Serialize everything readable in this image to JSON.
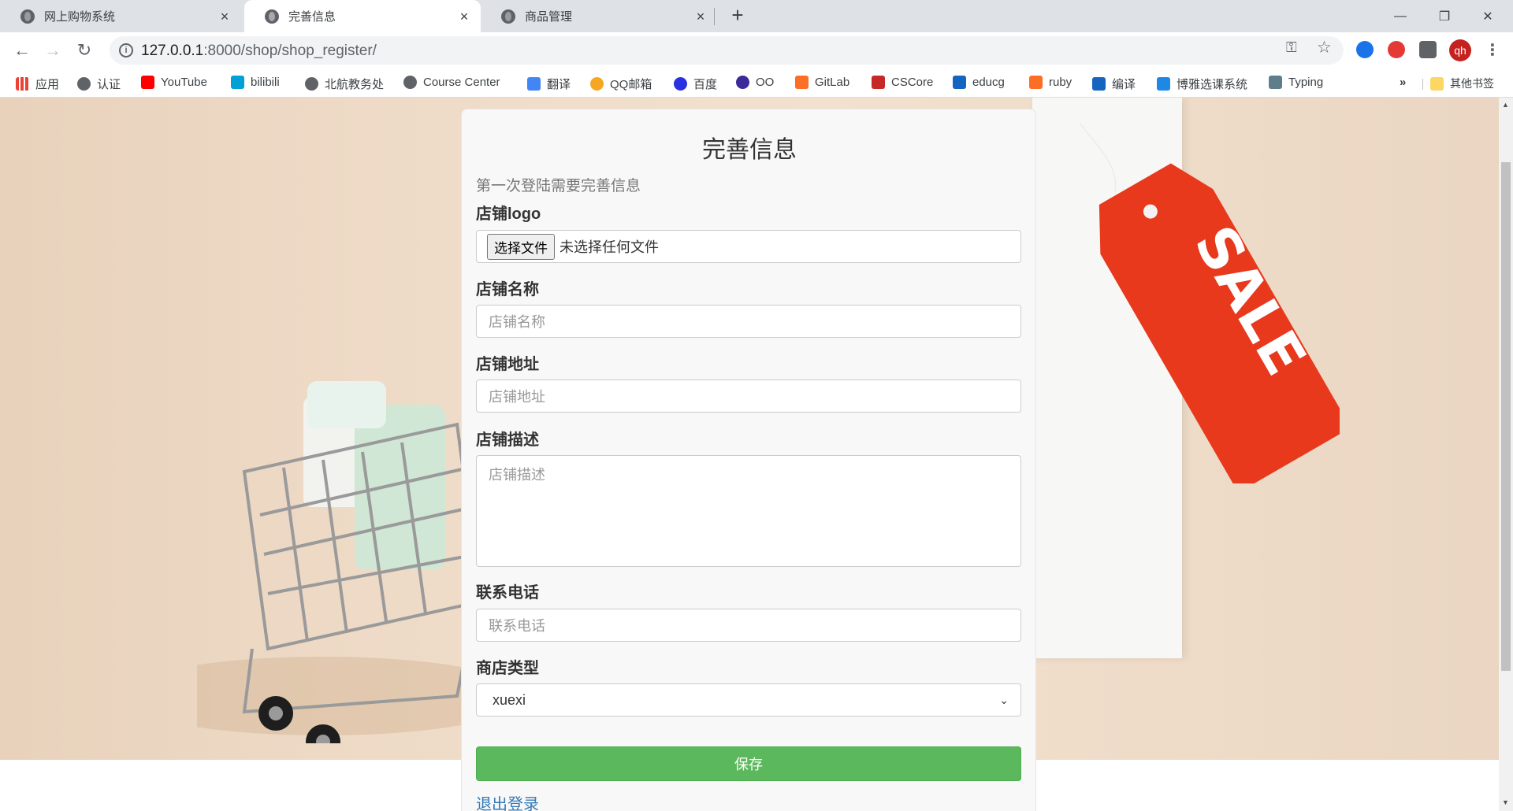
{
  "browser": {
    "tabs": [
      {
        "title": "网上购物系统",
        "active": false
      },
      {
        "title": "完善信息",
        "active": true
      },
      {
        "title": "商品管理",
        "active": false
      }
    ],
    "new_tab": "+",
    "window_controls": {
      "minimize": "—",
      "restore": "❐",
      "close": "✕"
    },
    "nav": {
      "back": "←",
      "forward": "→",
      "reload": "↻"
    },
    "url_host": "127.0.0.1",
    "url_rest": ":8000/shop/shop_register/",
    "omnibox_icons": {
      "key": "⚿",
      "star": "☆"
    },
    "avatar": "qh",
    "menu": "⋮",
    "extension_colors": [
      "#1a73e8",
      "#e53935",
      "#5f6368"
    ],
    "bookmarks": [
      {
        "label": "应用",
        "icon": "apps-icon",
        "color": "#ea4335"
      },
      {
        "label": "认证",
        "icon": "globe-icon",
        "color": "#5f6368"
      },
      {
        "label": "YouTube",
        "icon": "youtube-icon",
        "color": "#ff0000"
      },
      {
        "label": "bilibili",
        "icon": "bilibili-icon",
        "color": "#00a1d6"
      },
      {
        "label": "北航教务处",
        "icon": "globe-icon",
        "color": "#5f6368"
      },
      {
        "label": "Course Center",
        "icon": "globe-icon",
        "color": "#5f6368"
      },
      {
        "label": "翻译",
        "icon": "translate-icon",
        "color": "#4285f4"
      },
      {
        "label": "QQ邮箱",
        "icon": "qqmail-icon",
        "color": "#f5a623"
      },
      {
        "label": "百度",
        "icon": "baidu-icon",
        "color": "#2932e1"
      },
      {
        "label": "OO",
        "icon": "hexagon-icon",
        "color": "#3c2a9b"
      },
      {
        "label": "GitLab",
        "icon": "gitlab-icon",
        "color": "#fc6d26"
      },
      {
        "label": "CSCore",
        "icon": "cscore-icon",
        "color": "#c62828"
      },
      {
        "label": "educg",
        "icon": "educg-icon",
        "color": "#1565c0"
      },
      {
        "label": "ruby",
        "icon": "gitlab-icon",
        "color": "#fc6d26"
      },
      {
        "label": "编译",
        "icon": "educg-icon",
        "color": "#1565c0"
      },
      {
        "label": "博雅选课系统",
        "icon": "book-icon",
        "color": "#1e88e5"
      },
      {
        "label": "Typing",
        "icon": "typing-icon",
        "color": "#607d8b"
      }
    ],
    "bookmarks_overflow": "»",
    "other_bookmarks": "其他书签"
  },
  "page": {
    "title": "完善信息",
    "subtitle": "第一次登陆需要完善信息",
    "fields": {
      "logo": {
        "label": "店铺logo",
        "button": "选择文件",
        "status": "未选择任何文件"
      },
      "name": {
        "label": "店铺名称",
        "placeholder": "店铺名称"
      },
      "address": {
        "label": "店铺地址",
        "placeholder": "店铺地址"
      },
      "description": {
        "label": "店铺描述",
        "placeholder": "店铺描述"
      },
      "phone": {
        "label": "联系电话",
        "placeholder": "联系电话"
      },
      "type": {
        "label": "商店类型",
        "value": "xuexi"
      }
    },
    "save": "保存",
    "logout": "退出登录",
    "sale_tag": "SALE"
  }
}
